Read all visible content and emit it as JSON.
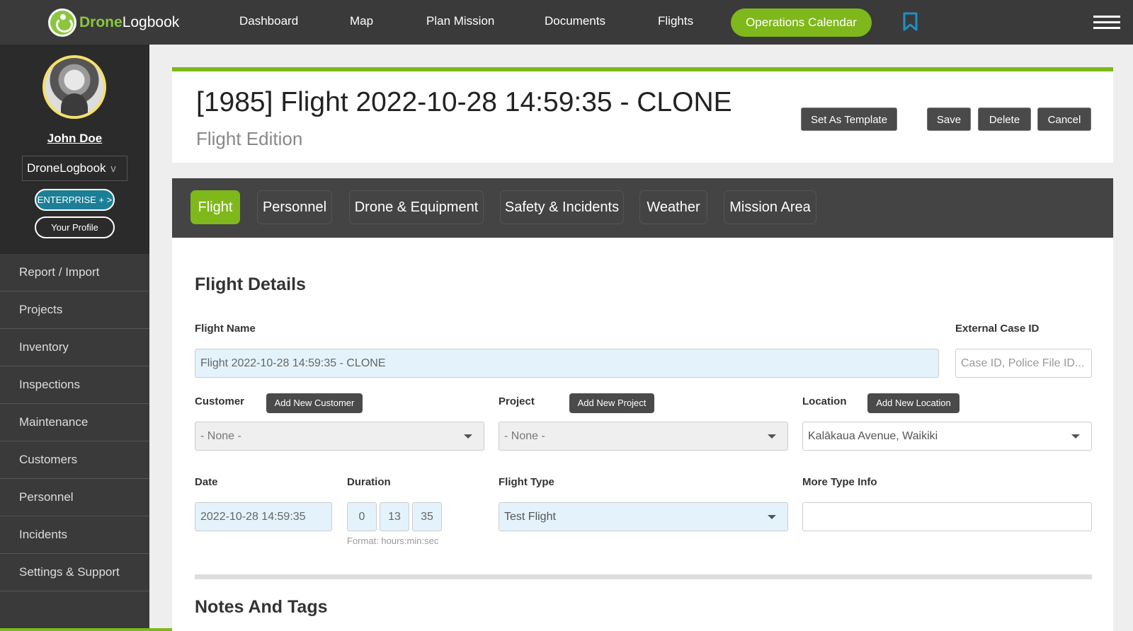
{
  "brand": {
    "name_part1": "Drone",
    "name_part2": "Logbook"
  },
  "nav": {
    "items": [
      "Dashboard",
      "Map",
      "Plan Mission",
      "Documents",
      "Flights"
    ],
    "calendar_label": "Operations Calendar"
  },
  "sidebar": {
    "username": "John Doe",
    "org": "DroneLogbook",
    "org_chevron": "v",
    "enterprise_label": "ENTERPRISE + >",
    "profile_label": "Your Profile",
    "items": [
      "Report / Import",
      "Projects",
      "Inventory",
      "Inspections",
      "Maintenance",
      "Customers",
      "Personnel",
      "Incidents",
      "Settings & Support"
    ]
  },
  "header": {
    "title": "[1985] Flight 2022-10-28 14:59:35 - CLONE",
    "subtitle": "Flight Edition",
    "buttons": {
      "template": "Set As Template",
      "save": "Save",
      "delete": "Delete",
      "cancel": "Cancel"
    }
  },
  "tabs": [
    "Flight",
    "Personnel",
    "Drone & Equipment",
    "Safety & Incidents",
    "Weather",
    "Mission Area"
  ],
  "form": {
    "section_title": "Flight Details",
    "flight_name": {
      "label": "Flight Name",
      "value": "Flight 2022-10-28 14:59:35 - CLONE"
    },
    "external_case_id": {
      "label": "External Case ID",
      "placeholder": "Case ID, Police File ID..."
    },
    "customer": {
      "label": "Customer",
      "add_label": "Add New Customer",
      "value": "- None -"
    },
    "project": {
      "label": "Project",
      "add_label": "Add New Project",
      "value": "- None -"
    },
    "location": {
      "label": "Location",
      "add_label": "Add New Location",
      "value": "Kalākaua Avenue, Waikiki"
    },
    "date": {
      "label": "Date",
      "value": "2022-10-28 14:59:35"
    },
    "duration": {
      "label": "Duration",
      "hours": "0",
      "minutes": "13",
      "seconds": "35",
      "hint": "Format: hours:min:sec"
    },
    "flight_type": {
      "label": "Flight Type",
      "value": "Test Flight"
    },
    "more_type_info": {
      "label": "More Type Info",
      "value": ""
    },
    "notes_title": "Notes And Tags"
  },
  "colors": {
    "accent": "#7fb81a",
    "dark": "#3a3a3a",
    "bookmark": "#1e90c8"
  }
}
